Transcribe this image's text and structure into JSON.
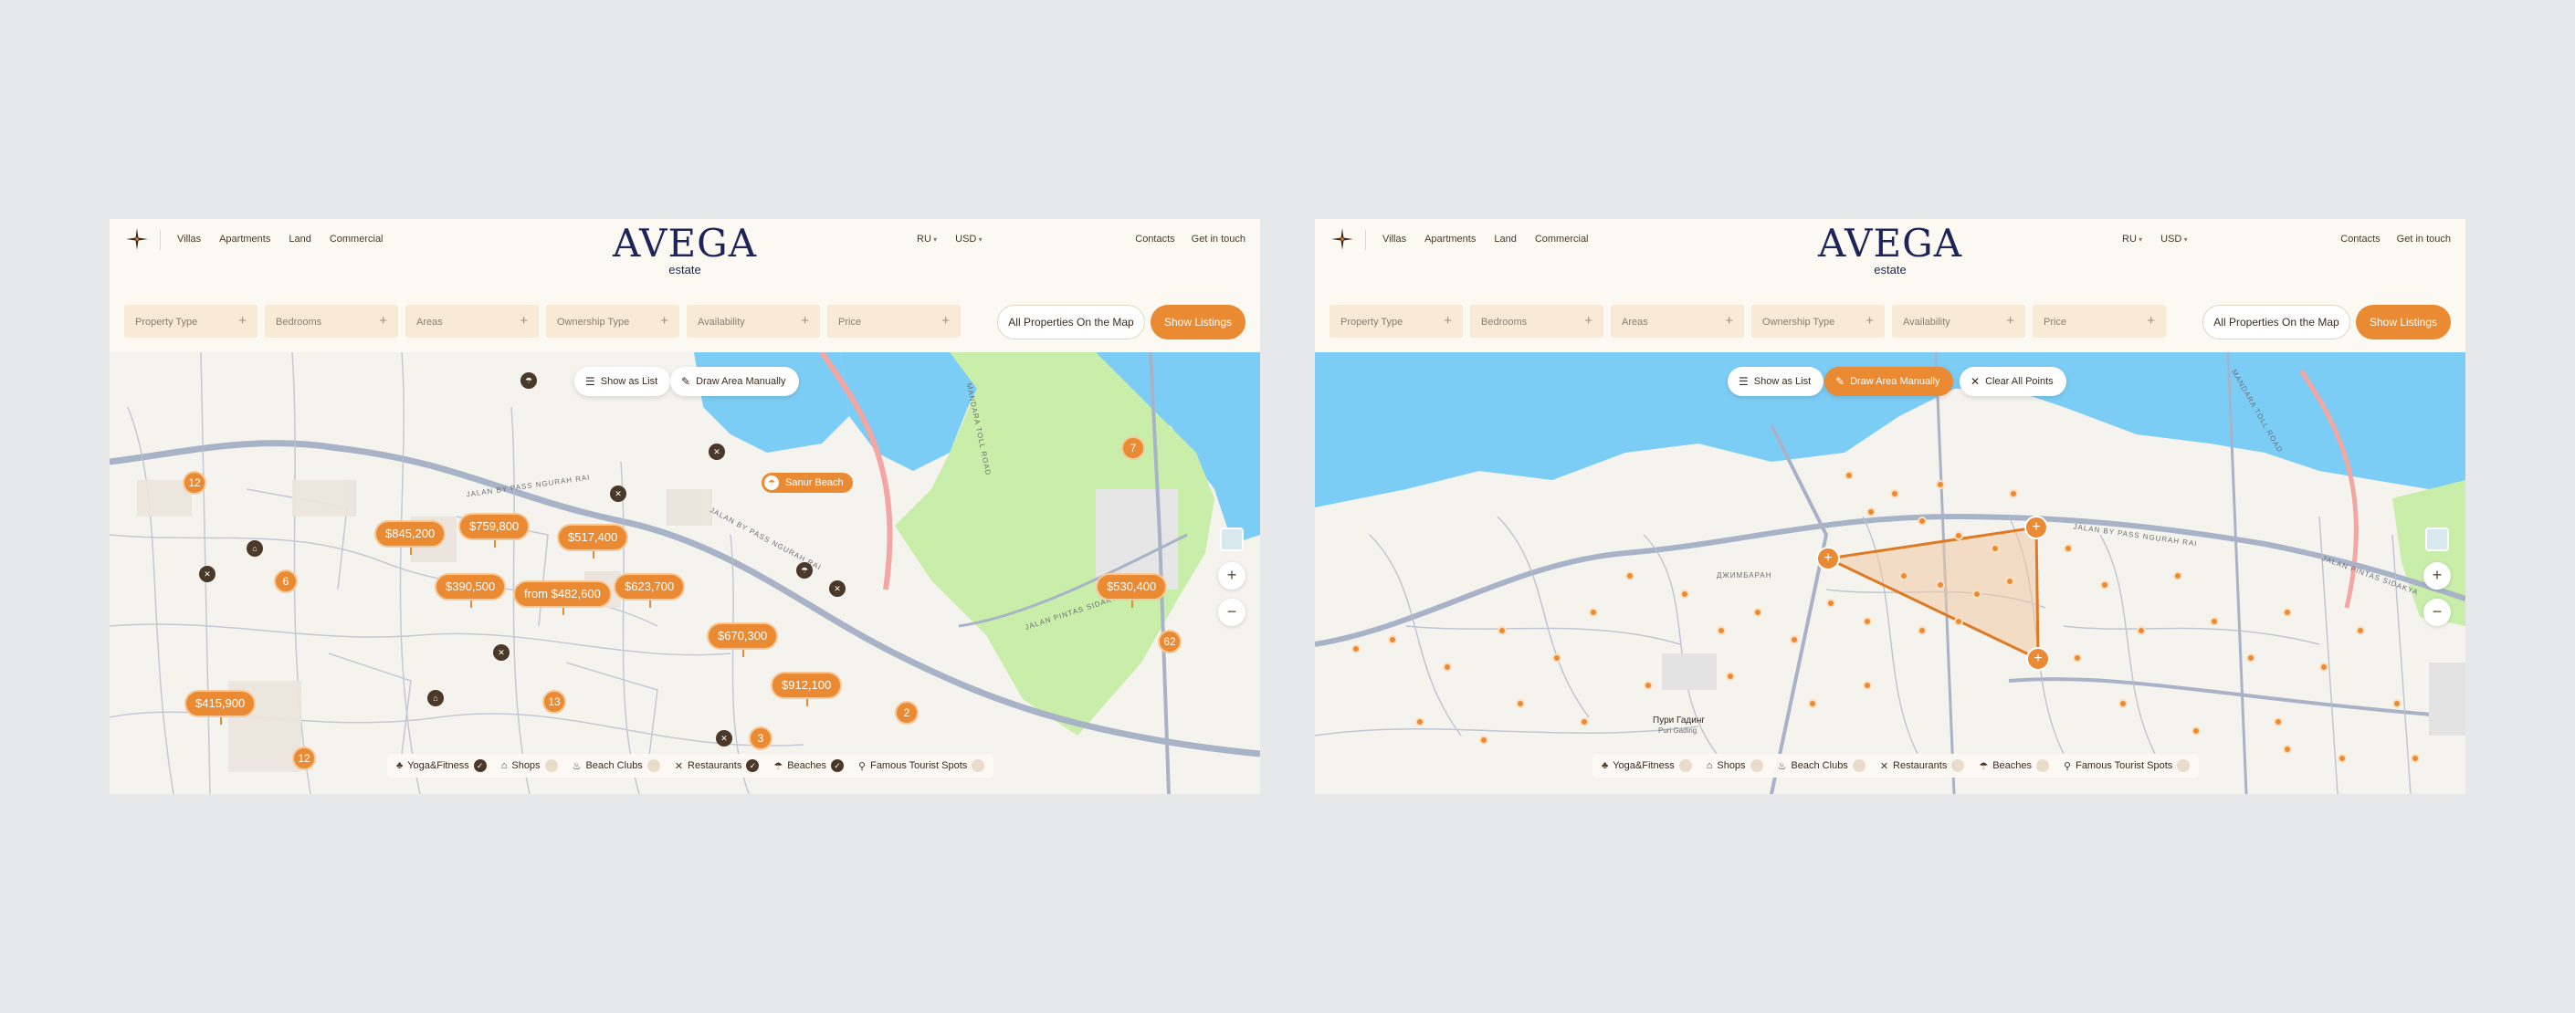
{
  "brand": {
    "logo_main": "AVEGA",
    "logo_sub": "estate",
    "accent": "#ea8a32",
    "dark": "#1d2458"
  },
  "nav": [
    "Villas",
    "Apartments",
    "Land",
    "Commercial"
  ],
  "lang": {
    "language": "RU",
    "currency": "USD"
  },
  "header_right": {
    "contacts": "Contacts",
    "get_in_touch": "Get in touch"
  },
  "filters": [
    "Property Type",
    "Bedrooms",
    "Areas",
    "Ownership Type",
    "Availability",
    "Price"
  ],
  "actions": {
    "all_on_map": "All Properties On the Map",
    "show_listings": "Show Listings"
  },
  "map_controls": {
    "show_as_list": "Show as List",
    "draw_area": "Draw Area Manually",
    "clear_points": "Clear All Points",
    "zoom_in": "+",
    "zoom_out": "−"
  },
  "map_labels": {
    "road1": "JALAN BY PASS NGURAH RAI",
    "road2": "MANDARA TOLL ROAD",
    "road3": "JALAN PINTAS SIDAKYA",
    "road4": "JALAN BY PASS NGURAH RAI",
    "place1": "Пури Гадинг",
    "place2": "Puri Gading",
    "place3": "ДЖИМБАРАН"
  },
  "panel_a": {
    "prices": [
      "$845,200",
      "$759,800",
      "$517,400",
      "$390,500",
      "from $482,600",
      "$623,700",
      "$670,300",
      "$530,400",
      "$912,100",
      "$415,900"
    ],
    "clusters": [
      "12",
      "6",
      "7",
      "62",
      "13",
      "12",
      "2",
      "3"
    ],
    "poi_label": "Sanur Beach"
  },
  "legend": [
    {
      "label": "Yoga&Fitness",
      "icon": "yoga-icon",
      "checked": true
    },
    {
      "label": "Shops",
      "icon": "shop-icon",
      "checked": false
    },
    {
      "label": "Beach Clubs",
      "icon": "beach-club-icon",
      "checked": false
    },
    {
      "label": "Restaurants",
      "icon": "restaurant-icon",
      "checked": true
    },
    {
      "label": "Beaches",
      "icon": "beach-icon",
      "checked": true
    },
    {
      "label": "Famous Tourist Spots",
      "icon": "pin-icon",
      "checked": false
    }
  ],
  "legend_b": [
    {
      "label": "Yoga&Fitness",
      "checked": false
    },
    {
      "label": "Shops",
      "checked": false
    },
    {
      "label": "Beach Clubs",
      "checked": false
    },
    {
      "label": "Restaurants",
      "checked": false
    },
    {
      "label": "Beaches",
      "checked": false
    },
    {
      "label": "Famous Tourist Spots",
      "checked": false
    }
  ]
}
